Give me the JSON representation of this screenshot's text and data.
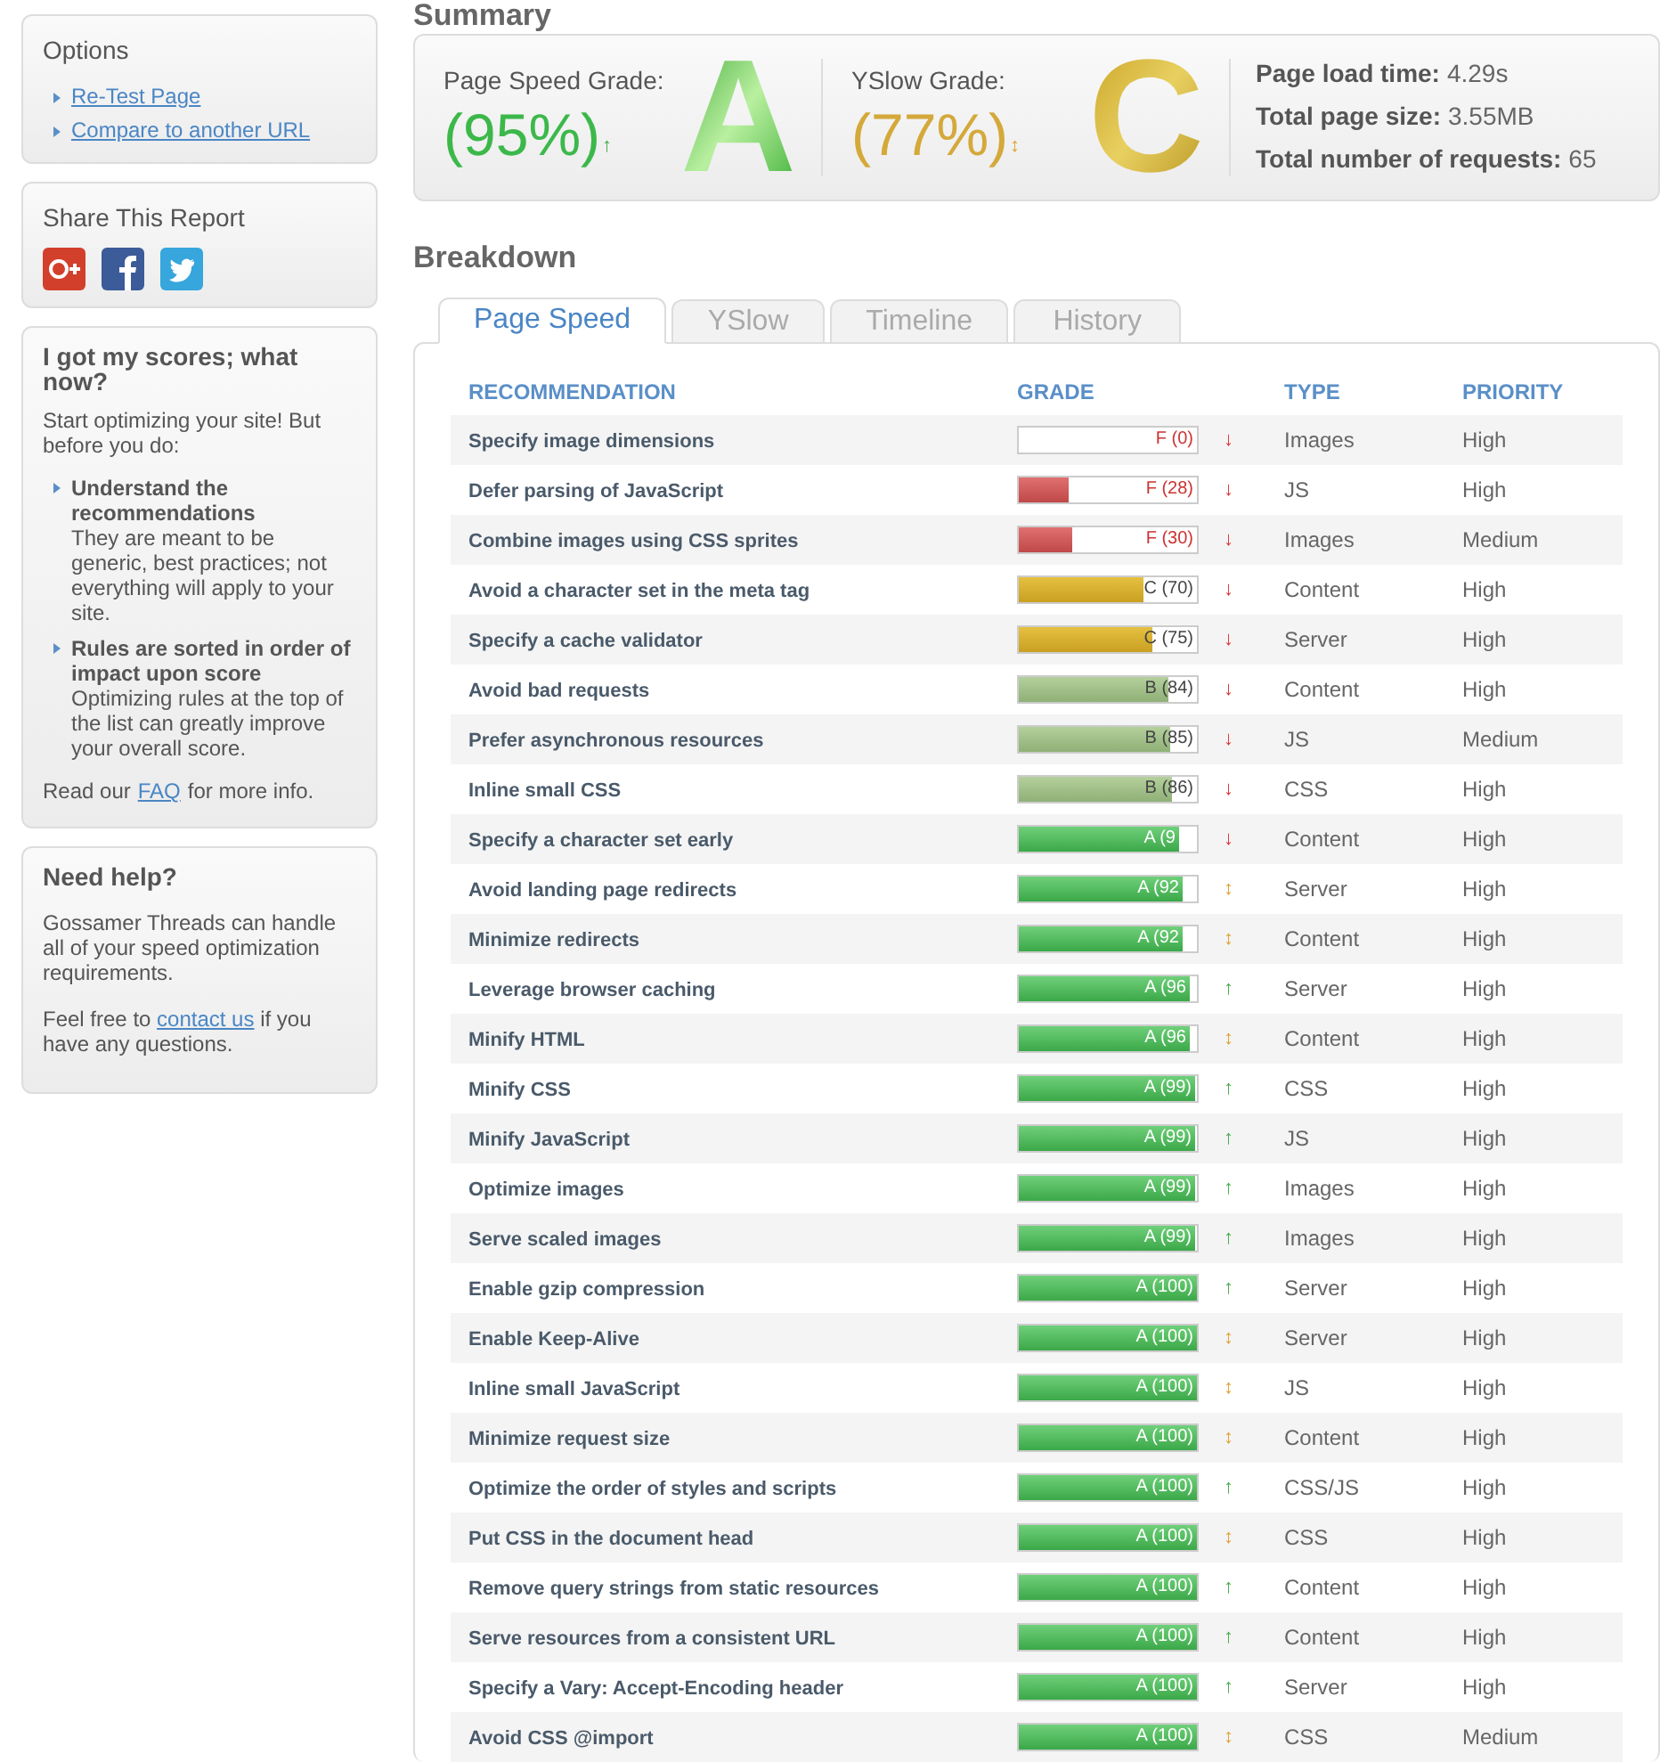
{
  "sidebar": {
    "options": {
      "title": "Options",
      "links": [
        "Re-Test Page",
        "Compare to another URL"
      ]
    },
    "share": {
      "title": "Share This Report"
    },
    "scores_help": {
      "title": "I got my scores; what now?",
      "intro": "Start optimizing your site! But before you do:",
      "points": [
        {
          "heading": "Understand the recommendations",
          "text": "They are meant to be generic, best practices; not everything will apply to your site."
        },
        {
          "heading": "Rules are sorted in order of impact upon score",
          "text": "Optimizing rules at the top of the list can greatly improve your overall score."
        }
      ],
      "footer_before": "Read our",
      "footer_link": "FAQ",
      "footer_after": "for more info."
    },
    "need_help": {
      "title": "Need help?",
      "text": "Gossamer Threads can handle all of your speed optimization requirements.",
      "contact_before": "Feel free to",
      "contact_link": "contact us",
      "contact_after": "if you have any questions."
    }
  },
  "summary": {
    "title": "Summary",
    "page_speed": {
      "label": "Page Speed Grade:",
      "score": "(95%)",
      "letter": "A",
      "kind": "a",
      "arrow": "↑",
      "color": "#44aa44"
    },
    "yslow": {
      "label": "YSlow Grade:",
      "score": "(77%)",
      "letter": "C",
      "kind": "c",
      "arrow": "↕",
      "color": "#e0a030"
    },
    "stats": [
      {
        "label": "Page load time:",
        "value": "4.29s"
      },
      {
        "label": "Total page size:",
        "value": "3.55MB"
      },
      {
        "label": "Total number of requests:",
        "value": "65"
      }
    ]
  },
  "breakdown": {
    "title": "Breakdown",
    "tabs": [
      {
        "label": "Page Speed",
        "selected": true
      },
      {
        "label": "YSlow",
        "selected": false
      },
      {
        "label": "Timeline",
        "selected": false
      },
      {
        "label": "History",
        "selected": false
      }
    ],
    "columns": [
      "RECOMMENDATION",
      "GRADE",
      "TYPE",
      "PRIORITY"
    ],
    "rows": [
      {
        "name": "Specify image dimensions",
        "grade": "F (0)",
        "kind": "f",
        "level": 0,
        "arrow": "↓",
        "color": "#dd3333",
        "type": "Images",
        "priority": "High"
      },
      {
        "name": "Defer parsing of JavaScript",
        "grade": "F (28)",
        "kind": "f",
        "level": 0.28,
        "arrow": "↓",
        "color": "#dd3333",
        "type": "JS",
        "priority": "High"
      },
      {
        "name": "Combine images using CSS sprites",
        "grade": "F (30)",
        "kind": "f",
        "level": 0.3,
        "arrow": "↓",
        "color": "#dd3333",
        "type": "Images",
        "priority": "Medium"
      },
      {
        "name": "Avoid a character set in the meta tag",
        "grade": "C (70)",
        "kind": "c",
        "level": 0.7,
        "arrow": "↓",
        "color": "#dd3333",
        "type": "Content",
        "priority": "High"
      },
      {
        "name": "Specify a cache validator",
        "grade": "C (75)",
        "kind": "c",
        "level": 0.75,
        "arrow": "↓",
        "color": "#dd3333",
        "type": "Server",
        "priority": "High"
      },
      {
        "name": "Avoid bad requests",
        "grade": "B (84)",
        "kind": "b",
        "level": 0.84,
        "arrow": "↓",
        "color": "#dd3333",
        "type": "Content",
        "priority": "High"
      },
      {
        "name": "Prefer asynchronous resources",
        "grade": "B (85)",
        "kind": "b",
        "level": 0.85,
        "arrow": "↓",
        "color": "#dd3333",
        "type": "JS",
        "priority": "Medium"
      },
      {
        "name": "Inline small CSS",
        "grade": "B (86)",
        "kind": "b",
        "level": 0.86,
        "arrow": "↓",
        "color": "#dd3333",
        "type": "CSS",
        "priority": "High"
      },
      {
        "name": "Specify a character set early",
        "grade": "A (9",
        "kind": "a",
        "level": 0.9,
        "arrow": "↓",
        "color": "#dd3333",
        "type": "Content",
        "priority": "High"
      },
      {
        "name": "Avoid landing page redirects",
        "grade": "A (92",
        "kind": "a",
        "level": 0.92,
        "arrow": "↕",
        "color": "#e0a030",
        "type": "Server",
        "priority": "High"
      },
      {
        "name": "Minimize redirects",
        "grade": "A (92",
        "kind": "a",
        "level": 0.92,
        "arrow": "↕",
        "color": "#e0a030",
        "type": "Content",
        "priority": "High"
      },
      {
        "name": "Leverage browser caching",
        "grade": "A (96",
        "kind": "a",
        "level": 0.96,
        "arrow": "↑",
        "color": "#44aa44",
        "type": "Server",
        "priority": "High"
      },
      {
        "name": "Minify HTML",
        "grade": "A (96",
        "kind": "a",
        "level": 0.96,
        "arrow": "↕",
        "color": "#e0a030",
        "type": "Content",
        "priority": "High"
      },
      {
        "name": "Minify CSS",
        "grade": "A (99)",
        "kind": "a",
        "level": 0.99,
        "arrow": "↑",
        "color": "#44aa44",
        "type": "CSS",
        "priority": "High"
      },
      {
        "name": "Minify JavaScript",
        "grade": "A (99)",
        "kind": "a",
        "level": 0.99,
        "arrow": "↑",
        "color": "#44aa44",
        "type": "JS",
        "priority": "High"
      },
      {
        "name": "Optimize images",
        "grade": "A (99)",
        "kind": "a",
        "level": 0.99,
        "arrow": "↑",
        "color": "#44aa44",
        "type": "Images",
        "priority": "High"
      },
      {
        "name": "Serve scaled images",
        "grade": "A (99)",
        "kind": "a",
        "level": 0.99,
        "arrow": "↑",
        "color": "#44aa44",
        "type": "Images",
        "priority": "High"
      },
      {
        "name": "Enable gzip compression",
        "grade": "A (100)",
        "kind": "a",
        "level": 1,
        "arrow": "↑",
        "color": "#44aa44",
        "type": "Server",
        "priority": "High"
      },
      {
        "name": "Enable Keep-Alive",
        "grade": "A (100)",
        "kind": "a",
        "level": 1,
        "arrow": "↕",
        "color": "#e0a030",
        "type": "Server",
        "priority": "High"
      },
      {
        "name": "Inline small JavaScript",
        "grade": "A (100)",
        "kind": "a",
        "level": 1,
        "arrow": "↕",
        "color": "#e0a030",
        "type": "JS",
        "priority": "High"
      },
      {
        "name": "Minimize request size",
        "grade": "A (100)",
        "kind": "a",
        "level": 1,
        "arrow": "↕",
        "color": "#e0a030",
        "type": "Content",
        "priority": "High"
      },
      {
        "name": "Optimize the order of styles and scripts",
        "grade": "A (100)",
        "kind": "a",
        "level": 1,
        "arrow": "↑",
        "color": "#44aa44",
        "type": "CSS/JS",
        "priority": "High"
      },
      {
        "name": "Put CSS in the document head",
        "grade": "A (100)",
        "kind": "a",
        "level": 1,
        "arrow": "↕",
        "color": "#e0a030",
        "type": "CSS",
        "priority": "High"
      },
      {
        "name": "Remove query strings from static resources",
        "grade": "A (100)",
        "kind": "a",
        "level": 1,
        "arrow": "↑",
        "color": "#44aa44",
        "type": "Content",
        "priority": "High"
      },
      {
        "name": "Serve resources from a consistent URL",
        "grade": "A (100)",
        "kind": "a",
        "level": 1,
        "arrow": "↑",
        "color": "#44aa44",
        "type": "Content",
        "priority": "High"
      },
      {
        "name": "Specify a Vary: Accept-Encoding header",
        "grade": "A (100)",
        "kind": "a",
        "level": 1,
        "arrow": "↑",
        "color": "#44aa44",
        "type": "Server",
        "priority": "High"
      },
      {
        "name": "Avoid CSS @import",
        "grade": "A (100)",
        "kind": "a",
        "level": 1,
        "arrow": "↕",
        "color": "#e0a030",
        "type": "CSS",
        "priority": "Medium"
      }
    ]
  }
}
